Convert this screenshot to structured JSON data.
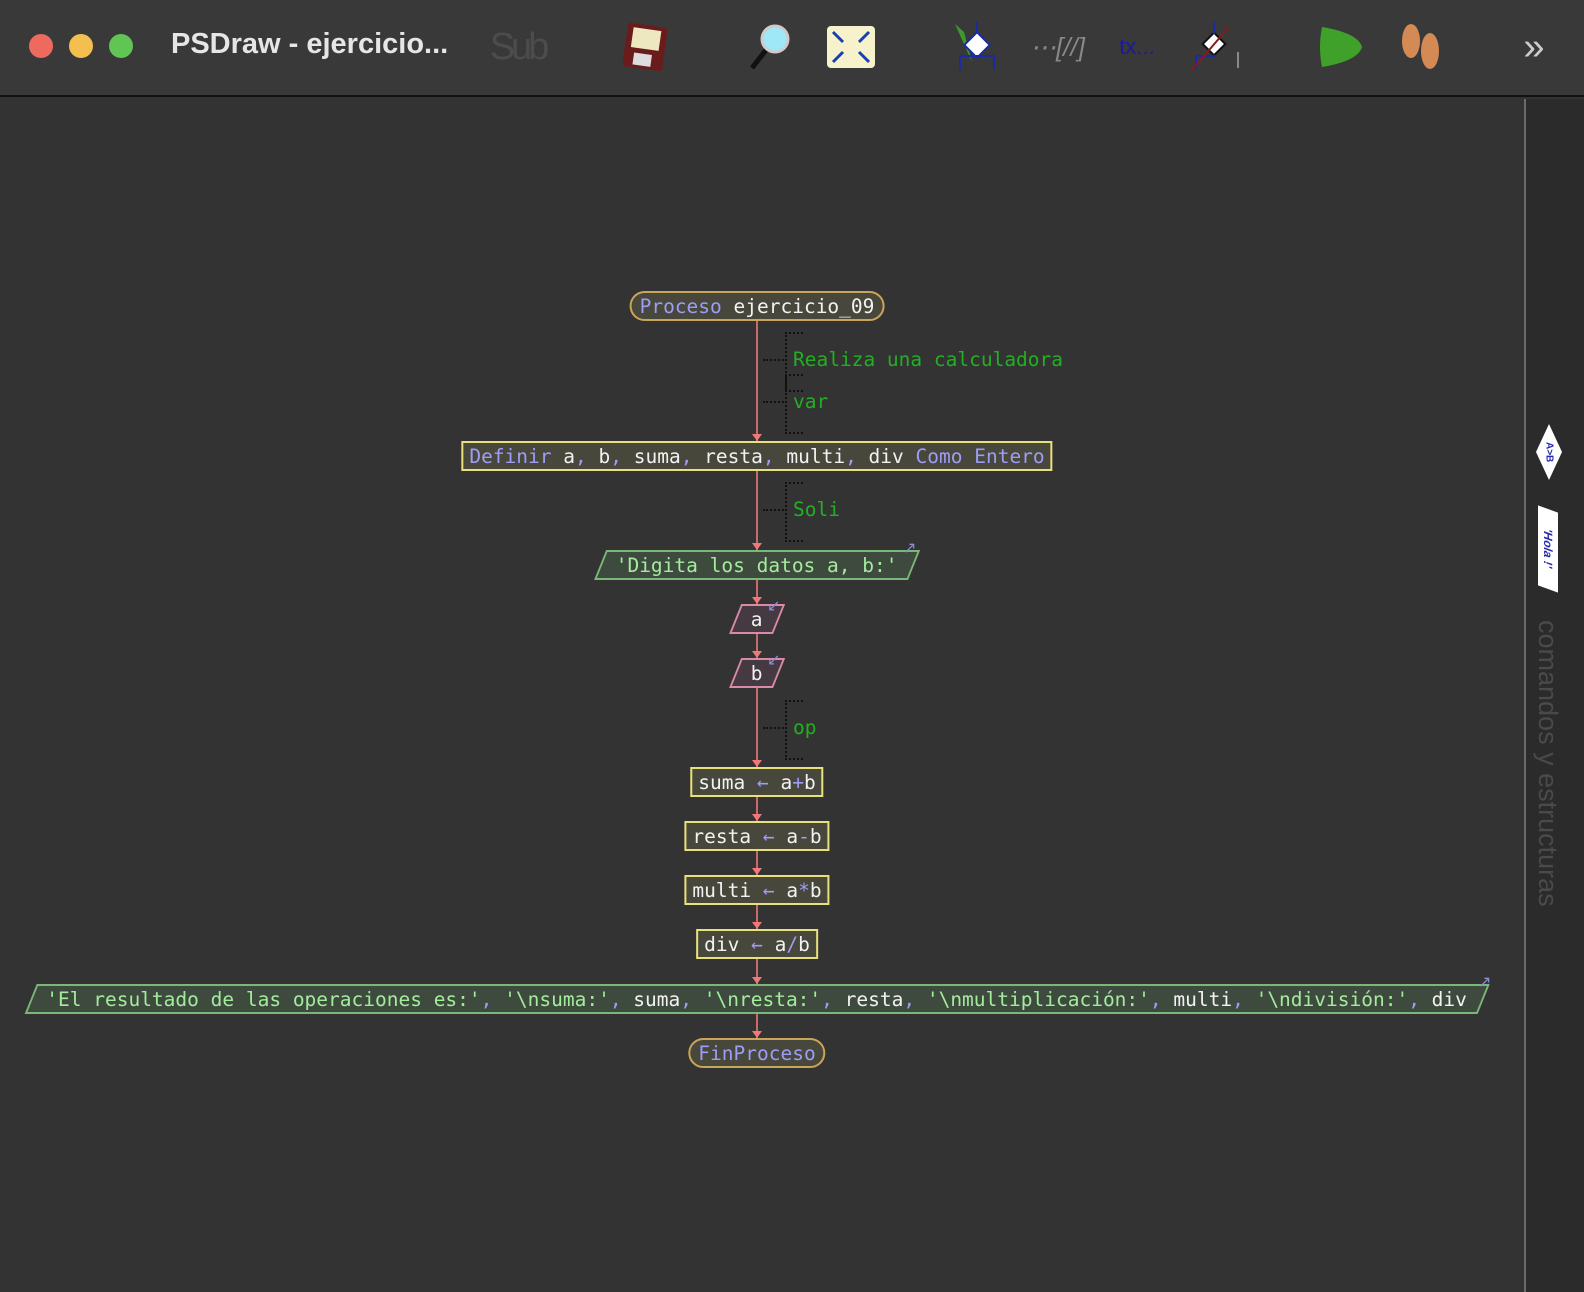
{
  "window": {
    "title": "PSDraw - ejercicio...",
    "controls": {
      "close": "#ee6a5f",
      "minimize": "#f5bf4f",
      "maximize": "#61c554"
    }
  },
  "toolbar": {
    "sub_label": "Sub",
    "comment_label": "tx...",
    "overflow": "»"
  },
  "side_panel": {
    "label": "comandos y estructuras",
    "diamond_label": "A>B",
    "output_label": "'Hola !'"
  },
  "flow": {
    "start": [
      [
        "Proceso ",
        "kw"
      ],
      [
        "ejercicio_09",
        "id"
      ]
    ],
    "comments": [
      "Realiza una calculadora",
      "var",
      "Soli",
      "op"
    ],
    "define": [
      [
        "Definir ",
        "kw"
      ],
      [
        "a",
        "id"
      ],
      [
        ", ",
        "op"
      ],
      [
        "b",
        "id"
      ],
      [
        ", ",
        "op"
      ],
      [
        "suma",
        "id"
      ],
      [
        ", ",
        "op"
      ],
      [
        "resta",
        "id"
      ],
      [
        ", ",
        "op"
      ],
      [
        "multi",
        "id"
      ],
      [
        ", ",
        "op"
      ],
      [
        "div ",
        "id"
      ],
      [
        "Como Entero",
        "kw"
      ]
    ],
    "prompt": [
      [
        "'Digita los datos a, b:'",
        "str"
      ]
    ],
    "read_a": [
      [
        "a",
        "id"
      ]
    ],
    "read_b": [
      [
        "b",
        "id"
      ]
    ],
    "assign_suma": [
      [
        "suma ",
        "id"
      ],
      [
        "← ",
        "op"
      ],
      [
        "a",
        "id"
      ],
      [
        "+",
        "op"
      ],
      [
        "b",
        "id"
      ]
    ],
    "assign_resta": [
      [
        "resta ",
        "id"
      ],
      [
        "← ",
        "op"
      ],
      [
        "a",
        "id"
      ],
      [
        "-",
        "op"
      ],
      [
        "b",
        "id"
      ]
    ],
    "assign_multi": [
      [
        "multi ",
        "id"
      ],
      [
        "← ",
        "op"
      ],
      [
        "a",
        "id"
      ],
      [
        "*",
        "op"
      ],
      [
        "b",
        "id"
      ]
    ],
    "assign_div": [
      [
        "div ",
        "id"
      ],
      [
        "← ",
        "op"
      ],
      [
        "a",
        "id"
      ],
      [
        "/",
        "op"
      ],
      [
        "b",
        "id"
      ]
    ],
    "result": [
      [
        "'El resultado de las operaciones es:'",
        "str"
      ],
      [
        ", ",
        "op"
      ],
      [
        "'\\nsuma:'",
        "str"
      ],
      [
        ", ",
        "op"
      ],
      [
        "suma",
        "id"
      ],
      [
        ", ",
        "op"
      ],
      [
        "'\\nresta:'",
        "str"
      ],
      [
        ", ",
        "op"
      ],
      [
        "resta",
        "id"
      ],
      [
        ", ",
        "op"
      ],
      [
        "'\\nmultiplicación:'",
        "str"
      ],
      [
        ", ",
        "op"
      ],
      [
        "multi",
        "id"
      ],
      [
        ", ",
        "op"
      ],
      [
        "'\\ndivisión:'",
        "str"
      ],
      [
        ", ",
        "op"
      ],
      [
        "div",
        "id"
      ]
    ],
    "end": [
      [
        "FinProceso",
        "kw"
      ]
    ]
  }
}
